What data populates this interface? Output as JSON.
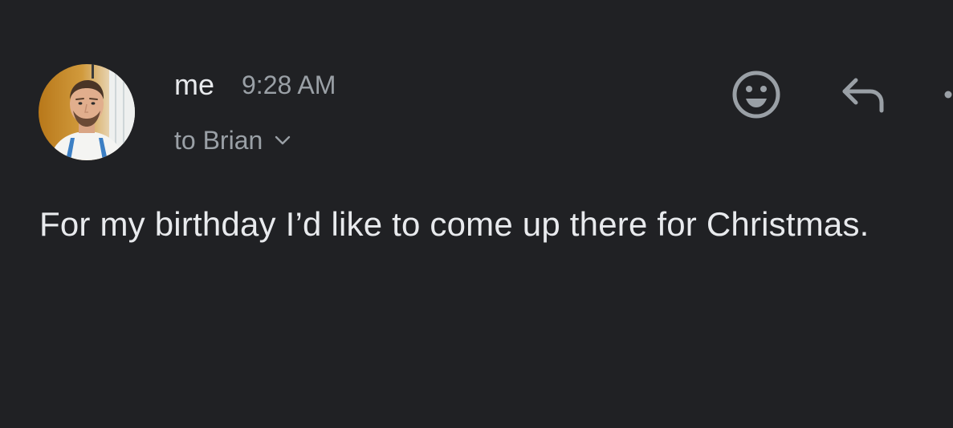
{
  "header": {
    "sender": "me",
    "time": "9:28 AM",
    "recipient": "to Brian",
    "avatar_icon": "profile-photo",
    "recipient_chevron_icon": "chevron-down-icon"
  },
  "actions": {
    "emoji_icon": "smiley-icon",
    "reply_icon": "reply-icon",
    "more_icon": "more-vert-icon"
  },
  "message": {
    "body": "For my birthday I’d like to come up there for Christmas."
  },
  "colors": {
    "background": "#202124",
    "primary_text": "#e8eaed",
    "secondary_text": "#9aa0a6",
    "icon": "#9aa0a6"
  }
}
